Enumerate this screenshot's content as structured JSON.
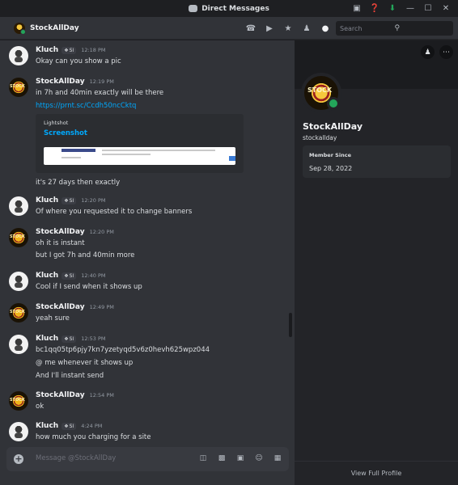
{
  "window": {
    "title": "Direct Messages"
  },
  "header": {
    "name": "StockAllDay",
    "search_placeholder": "Search"
  },
  "messages": [
    {
      "user": "Kluch",
      "tag": "SI",
      "time": "12:18 PM",
      "lines": [
        "Okay can you show a pic"
      ]
    },
    {
      "user": "StockAllDay",
      "tag": "",
      "time": "12:19 PM",
      "lines": [
        "in 7h and 40min exactly will be there",
        "https://prnt.sc/Ccdh50ncCktq",
        "it's 27 days then exactly"
      ],
      "embed": {
        "provider": "Lightshot",
        "title": "Screenshot"
      }
    },
    {
      "user": "Kluch",
      "tag": "SI",
      "time": "12:20 PM",
      "lines": [
        "Of where you requested it to change banners"
      ]
    },
    {
      "user": "StockAllDay",
      "tag": "",
      "time": "12:20 PM",
      "lines": [
        "oh it is instant",
        "but I got 7h and 40min more"
      ]
    },
    {
      "user": "Kluch",
      "tag": "SI",
      "time": "12:40 PM",
      "lines": [
        "Cool if I send when it shows up"
      ]
    },
    {
      "user": "StockAllDay",
      "tag": "",
      "time": "12:49 PM",
      "lines": [
        "yeah sure"
      ]
    },
    {
      "user": "Kluch",
      "tag": "SI",
      "time": "12:53 PM",
      "lines": [
        "bc1qq05tp6pjy7kn7yzetyqd5v6z0hevh625wpz044",
        "@ me whenever it shows up",
        "And I'll instant send"
      ]
    },
    {
      "user": "StockAllDay",
      "tag": "",
      "time": "12:54 PM",
      "lines": [
        "ok"
      ]
    },
    {
      "user": "Kluch",
      "tag": "SI",
      "time": "4:24 PM",
      "lines": [
        "how much you charging for a site"
      ]
    }
  ],
  "composer": {
    "placeholder": "Message @StockAllDay"
  },
  "profile": {
    "display_name": "StockAllDay",
    "username": "stockallday",
    "avatar_text": "STOCK",
    "member_since_label": "Member Since",
    "member_since": "Sep 28, 2022",
    "footer": "View Full Profile"
  },
  "colors": {
    "accent_link": "#00a8fc",
    "online": "#23a55a",
    "chat_bg": "#313338",
    "profile_bg": "#232428"
  }
}
